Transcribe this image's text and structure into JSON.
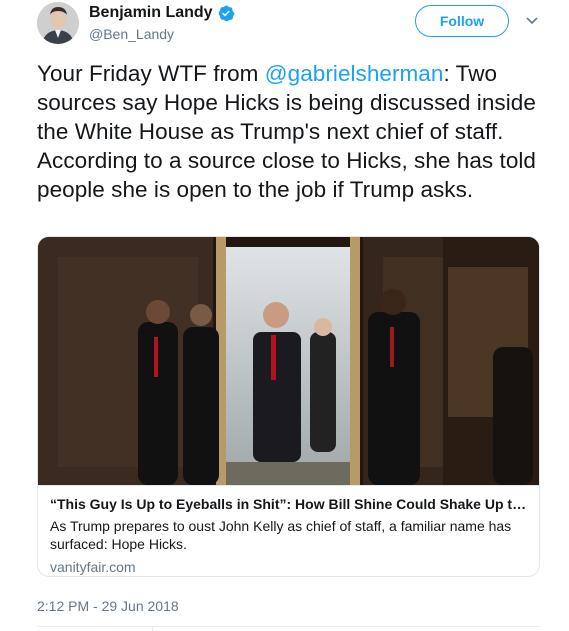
{
  "author": {
    "display_name": "Benjamin Landy",
    "handle": "@Ben_Landy",
    "verified": true
  },
  "actions": {
    "follow_label": "Follow"
  },
  "tweet": {
    "text_before_mention": "Your Friday WTF from ",
    "mention": "@gabrielsherman",
    "text_after_mention": ": Two sources say Hope Hicks is being discussed inside the White House as Trump's next chief of staff. According to a source close to Hicks, she has told people she is open to the job if Trump asks.",
    "timestamp": "2:12 PM - 29 Jun 2018"
  },
  "card": {
    "title": "“This Guy Is Up to Eyeballs in Shit”: How Bill Shine Could Shake Up the West...",
    "description": "As Trump prepares to oust John Kelly as chief of staff, a familiar name has surfaced: Hope Hicks.",
    "domain": "vanityfair.com"
  },
  "colors": {
    "accent": "#1da1f2",
    "text": "#14171a",
    "muted": "#657786",
    "border": "#e1e8ed"
  }
}
